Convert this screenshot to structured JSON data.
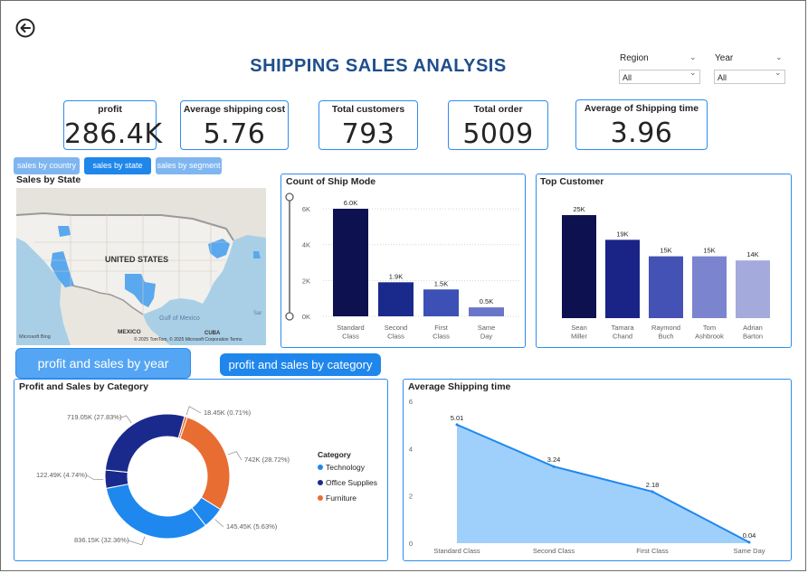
{
  "title": "SHIPPING SALES ANALYSIS",
  "filters": {
    "region": {
      "label": "Region",
      "value": "All"
    },
    "year": {
      "label": "Year",
      "value": "All"
    }
  },
  "kpis": [
    {
      "label": "profit",
      "value": "286.4K"
    },
    {
      "label": "Average shipping cost",
      "value": "5.76"
    },
    {
      "label": "Total customers",
      "value": "793"
    },
    {
      "label": "Total order",
      "value": "5009"
    },
    {
      "label": "Average of Shipping time",
      "value": "3.96"
    }
  ],
  "nav_pills": [
    "sales by country",
    "sales by state",
    "sales by segment"
  ],
  "nav_buttons": [
    "profit and sales by year",
    "profit and sales by category"
  ],
  "map": {
    "title": "Sales by State",
    "country_label": "UNITED STATES",
    "gulf_label": "Gulf of Mexico",
    "mexico_label": "MEXICO",
    "cuba_label": "CUBA",
    "sar_label": "Sar",
    "bing_label": "Microsoft Bing",
    "attribution": "© 2025 TomTom, © 2025 Microsoft Corporation Terms"
  },
  "colors": {
    "accent": "#2f8cf0",
    "title": "#1f4e8c",
    "navy": "#0d1150",
    "tech": "#1e88ee",
    "office": "#1a2a8c",
    "furniture": "#e86d32",
    "area": "#9fd0fb"
  },
  "chart_data": [
    {
      "type": "bar",
      "title": "Count of Ship Mode",
      "categories": [
        "Standard Class",
        "Second Class",
        "First Class",
        "Same Day"
      ],
      "values": [
        6000,
        1900,
        1500,
        500
      ],
      "data_labels": [
        "6.0K",
        "1.9K",
        "1.5K",
        "0.5K"
      ],
      "y_ticks": [
        "0K",
        "2K",
        "4K",
        "6K"
      ],
      "ylim": [
        0,
        6600
      ],
      "grid": true,
      "colors": [
        "#0d1150",
        "#1a2a8c",
        "#3d50b5",
        "#6a77c9"
      ]
    },
    {
      "type": "bar",
      "title": "Top Customer",
      "categories": [
        "Sean Miller",
        "Tamara Chand",
        "Raymond Buch",
        "Tom Ashbrook",
        "Adrian Barton"
      ],
      "values": [
        25000,
        19000,
        15000,
        15000,
        14000
      ],
      "data_labels": [
        "25K",
        "19K",
        "15K",
        "15K",
        "14K"
      ],
      "ylim": [
        0,
        27000
      ],
      "colors": [
        "#0d1150",
        "#1a2386",
        "#4451b5",
        "#7b84cf",
        "#a4aadc"
      ]
    },
    {
      "type": "pie",
      "title": "Profit and Sales by Category",
      "legend_title": "Category",
      "legend": [
        "Technology",
        "Office Supplies",
        "Furniture"
      ],
      "slices": [
        {
          "label": "18.45K (0.71%)",
          "value": 0.71,
          "category": "Furniture",
          "color": "#e86d32"
        },
        {
          "label": "742K (28.72%)",
          "value": 28.72,
          "category": "Furniture",
          "color": "#e86d32"
        },
        {
          "label": "145.45K (5.63%)",
          "value": 5.63,
          "category": "Technology",
          "color": "#1e88ee"
        },
        {
          "label": "836.15K (32.36%)",
          "value": 32.36,
          "category": "Technology",
          "color": "#1e88ee"
        },
        {
          "label": "122.49K (4.74%)",
          "value": 4.74,
          "category": "Office Supplies",
          "color": "#1a2a8c"
        },
        {
          "label": "719.05K (27.83%)",
          "value": 27.83,
          "category": "Office Supplies",
          "color": "#1a2a8c"
        }
      ]
    },
    {
      "type": "area",
      "title": "Average Shipping time",
      "categories": [
        "Standard Class",
        "Second Class",
        "First Class",
        "Same Day"
      ],
      "values": [
        5.01,
        3.24,
        2.18,
        0.04
      ],
      "data_labels": [
        "5.01",
        "3.24",
        "2.18",
        "0.04"
      ],
      "y_ticks": [
        "0",
        "2",
        "4",
        "6"
      ],
      "ylim": [
        0,
        6
      ]
    }
  ]
}
